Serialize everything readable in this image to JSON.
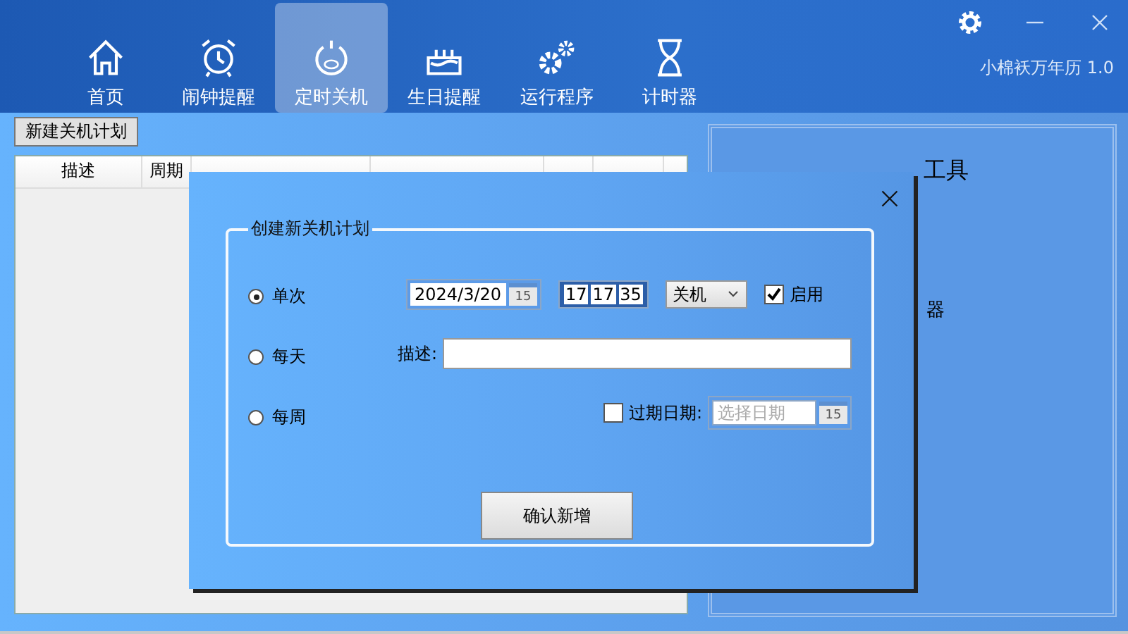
{
  "app": {
    "title": "小棉袄万年历 1.0"
  },
  "nav": [
    {
      "label": "首页",
      "selected": false
    },
    {
      "label": "闹钟提醒",
      "selected": false
    },
    {
      "label": "定时关机",
      "selected": true
    },
    {
      "label": "生日提醒",
      "selected": false
    },
    {
      "label": "运行程序",
      "selected": false
    },
    {
      "label": "计时器",
      "selected": false
    }
  ],
  "toolbar": {
    "new_button": "新建关机计划"
  },
  "table": {
    "columns": [
      "描述",
      "周期"
    ]
  },
  "side_panel": {
    "title": "工具",
    "item_label": "器"
  },
  "dialog": {
    "group_title": "创建新关机计划",
    "frequency": [
      {
        "label": "单次",
        "selected": true
      },
      {
        "label": "每天",
        "selected": false
      },
      {
        "label": "每周",
        "selected": false
      }
    ],
    "date": "2024/3/20",
    "calendar_day": "15",
    "time": [
      "17",
      "17",
      "35"
    ],
    "action": "关机",
    "enabled_label": "启用",
    "enabled": true,
    "description_label": "描述:",
    "expiry": {
      "label": "过期日期:",
      "checked": false,
      "placeholder": "选择日期",
      "calendar_day": "15"
    },
    "confirm": "确认新增"
  }
}
